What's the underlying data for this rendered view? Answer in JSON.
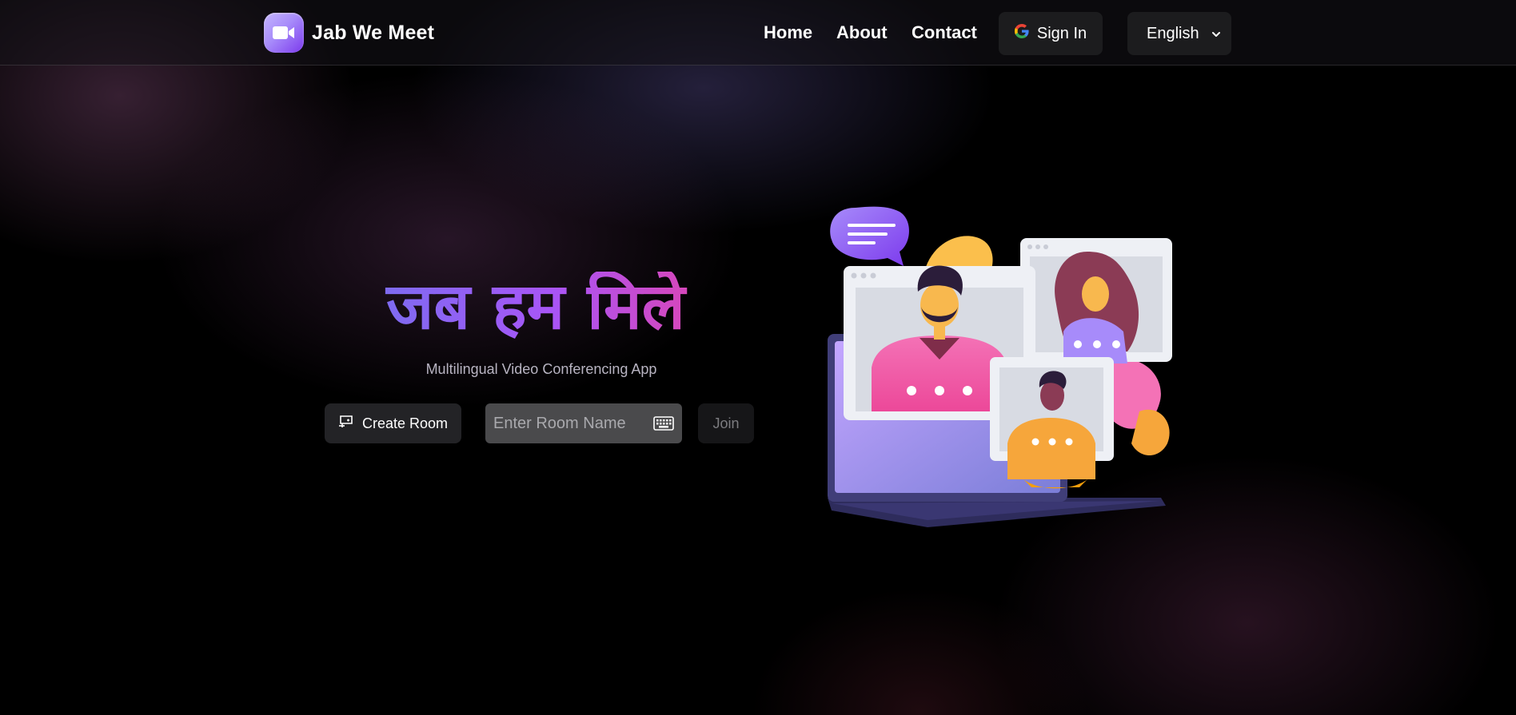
{
  "header": {
    "brand_title": "Jab We Meet",
    "nav": [
      {
        "label": "Home"
      },
      {
        "label": "About"
      },
      {
        "label": "Contact"
      }
    ],
    "sign_in_label": "Sign In",
    "language": {
      "selected": "English"
    }
  },
  "hero": {
    "title": "जब हम मिले",
    "subtitle": "Multilingual Video Conferencing App",
    "create_room_label": "Create Room",
    "room_input": {
      "placeholder": "Enter Room Name",
      "value": ""
    },
    "join_label": "Join"
  },
  "icons": {
    "logo": "video-camera-icon",
    "sign_in": "google-icon",
    "language": "chevron-down-icon",
    "create_room": "screen-share-icon",
    "room_input": "keyboard-icon"
  },
  "colors": {
    "accent_purple": "#a855f7",
    "accent_pink": "#d946b8",
    "background": "#000000"
  }
}
